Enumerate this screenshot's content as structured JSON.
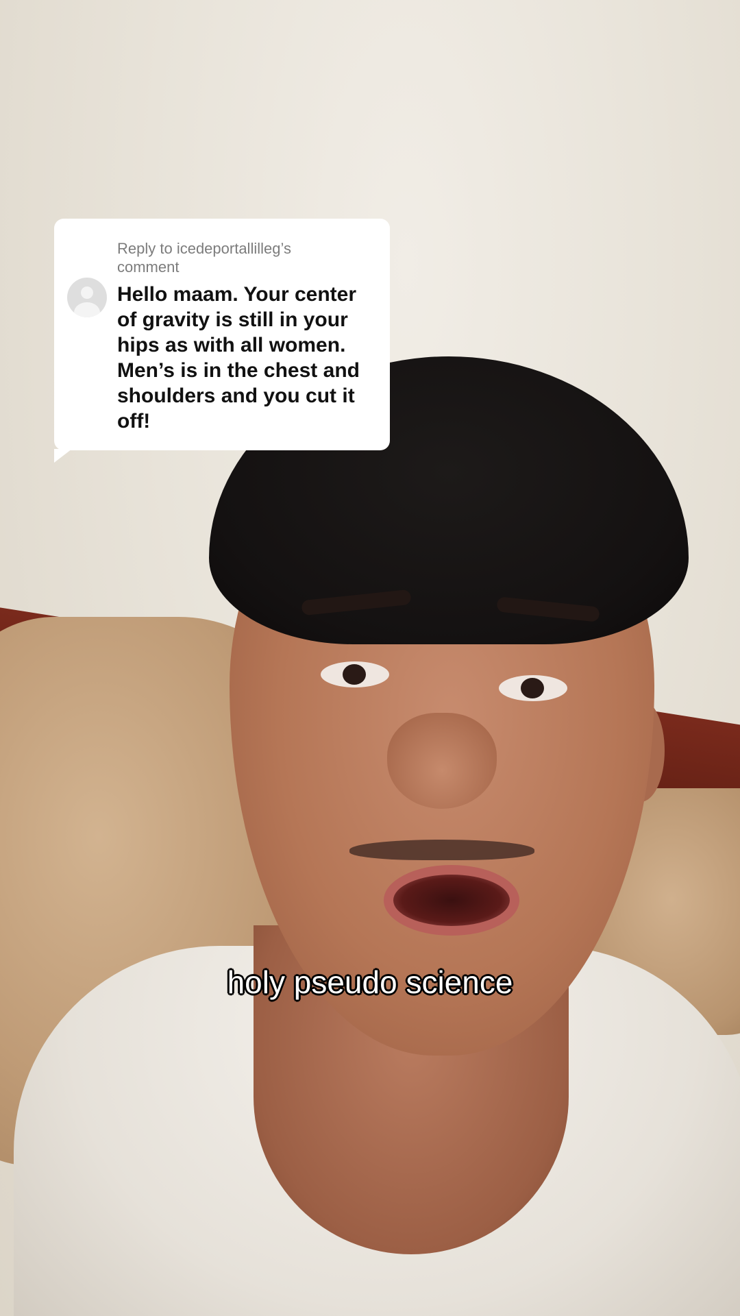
{
  "reply": {
    "label_prefix": "Reply to icedeportallilleg’s",
    "label_suffix": "comment",
    "comment": "Hello maam. Your center of gravity is still in your hips as with all women. Men’s is in the chest and shoulders and you cut it off!"
  },
  "caption": "holy pseudo science",
  "icons": {
    "avatar": "default-user-avatar-icon"
  }
}
